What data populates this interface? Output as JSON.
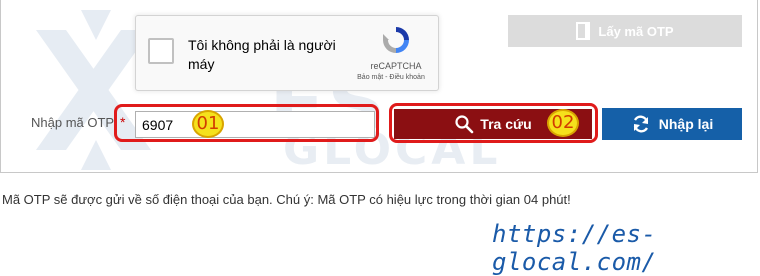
{
  "recaptcha": {
    "label": "Tôi không phải là người máy",
    "brand": "reCAPTCHA",
    "links": "Bảo mật - Điều khoản"
  },
  "otp_button": {
    "label": "Lấy mã OTP"
  },
  "form": {
    "otp_label": "Nhập mã OTP",
    "required_mark": "*",
    "otp_value": "6907"
  },
  "actions": {
    "search_label": "Tra cứu",
    "reset_label": "Nhập lại"
  },
  "annotations": {
    "step1": "01",
    "step2": "02"
  },
  "watermark": {
    "text": "ES",
    "subtext": "GLOCAL"
  },
  "note": "Mã OTP sẽ được gửi về số điện thoại của bạn. Chú ý: Mã OTP có hiệu lực trong thời gian 04 phút!",
  "website": "https://es-glocal.com/",
  "colors": {
    "search_button": "#8b0f12",
    "reset_button": "#1560a8",
    "otp_button_disabled": "#dcdcdc",
    "highlight": "#e01b1b",
    "badge": "#f5e11c"
  }
}
